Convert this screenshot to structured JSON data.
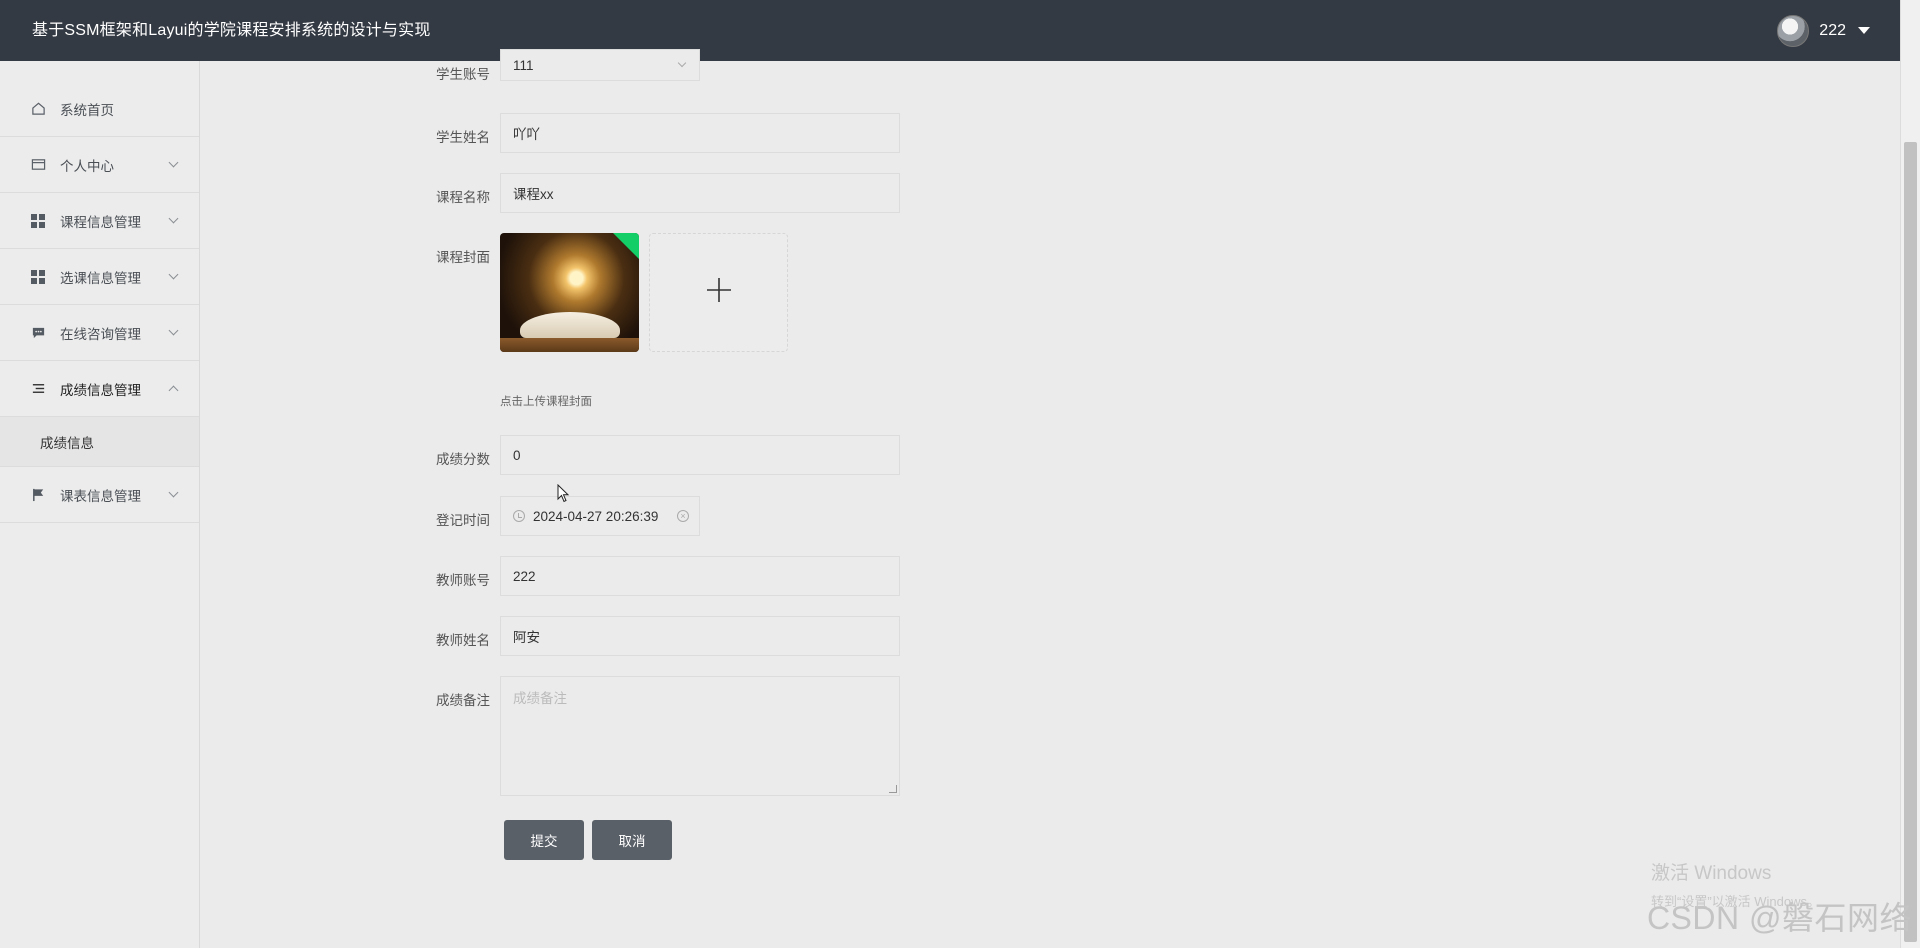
{
  "header": {
    "title": "基于SSM框架和Layui的学院课程安排系统的设计与实现",
    "user_name": "222"
  },
  "sidebar": {
    "items": [
      {
        "label": "系统首页",
        "icon": "home-icon"
      },
      {
        "label": "个人中心",
        "icon": "card-icon"
      },
      {
        "label": "课程信息管理",
        "icon": "grid-icon"
      },
      {
        "label": "选课信息管理",
        "icon": "grid-icon"
      },
      {
        "label": "在线咨询管理",
        "icon": "chat-icon"
      },
      {
        "label": "成绩信息管理",
        "icon": "list-icon"
      },
      {
        "label": "课表信息管理",
        "icon": "flag-icon"
      }
    ],
    "sub_item": "成绩信息"
  },
  "form": {
    "student_account_label": "学生账号",
    "student_account": "111",
    "student_name_label": "学生姓名",
    "student_name": "吖吖",
    "course_name_label": "课程名称",
    "course_name": "课程xx",
    "cover_label": "课程封面",
    "cover_hint": "点击上传课程封面",
    "score_label": "成绩分数",
    "score": "0",
    "time_label": "登记时间",
    "time": "2024-04-27 20:26:39",
    "teacher_account_label": "教师账号",
    "teacher_account": "222",
    "teacher_name_label": "教师姓名",
    "teacher_name": "阿安",
    "remark_label": "成绩备注",
    "remark_placeholder": "成绩备注",
    "submit": "提交",
    "cancel": "取消"
  },
  "watermark": {
    "line1": "激活 Windows",
    "line2": "转到“设置”以激活 Windows。",
    "csdn": "CSDN @磐石网络"
  },
  "colors": {
    "topbar": "#343a43",
    "button": "#5a6068",
    "upload_badge": "#13ce66"
  }
}
